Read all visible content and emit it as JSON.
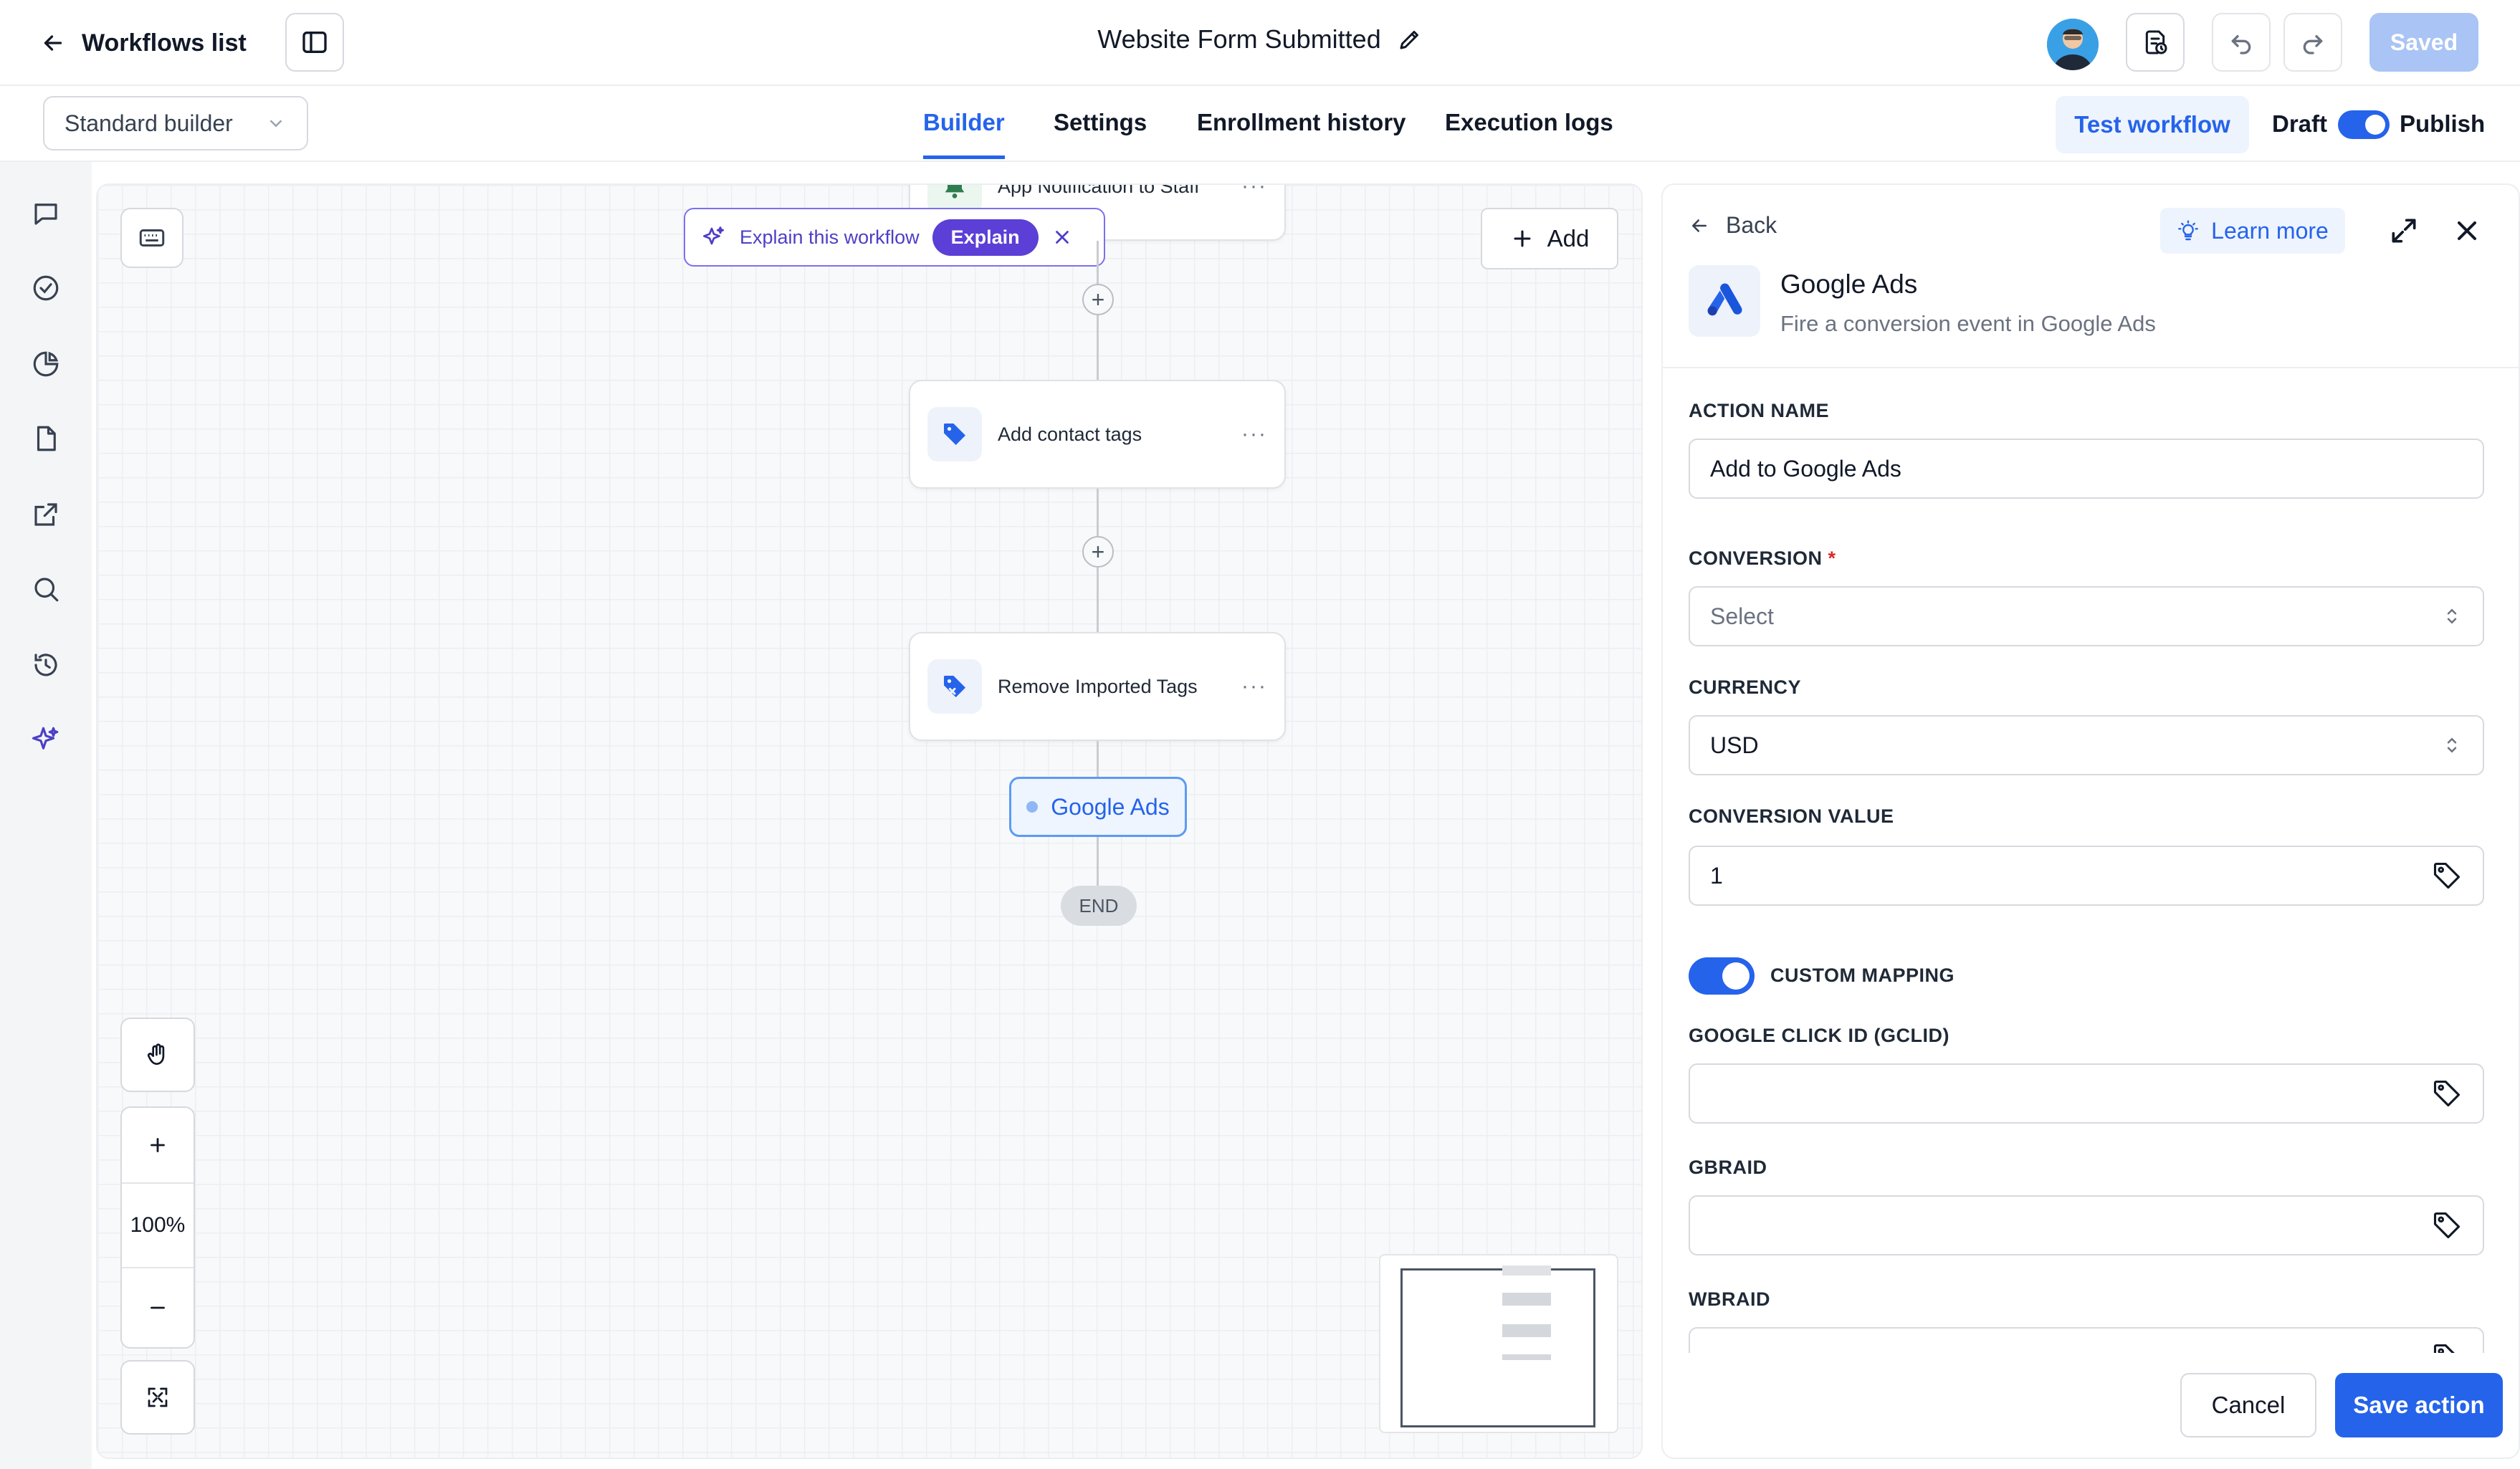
{
  "topbar": {
    "back_label": "Workflows list",
    "workflow_title": "Website Form Submitted",
    "saved_label": "Saved"
  },
  "subbar": {
    "builder_mode": "Standard builder",
    "tabs": [
      {
        "label": "Builder",
        "active": true
      },
      {
        "label": "Settings",
        "active": false
      },
      {
        "label": "Enrollment history",
        "active": false
      },
      {
        "label": "Execution logs",
        "active": false
      }
    ],
    "test_workflow_label": "Test workflow",
    "draft_label": "Draft",
    "publish_label": "Publish",
    "publish_toggle_on": true
  },
  "rail": {
    "icons": [
      "chat-icon",
      "check-circle-icon",
      "pie-chart-icon",
      "file-icon",
      "external-link-icon",
      "search-icon",
      "history-icon",
      "sparkles-icon"
    ]
  },
  "canvas": {
    "explain": {
      "text": "Explain this workflow",
      "button": "Explain"
    },
    "add_label": "Add",
    "nodes": [
      {
        "label": "App Notification to Staff"
      },
      {
        "label": "Add contact tags"
      },
      {
        "label": "Remove Imported Tags"
      }
    ],
    "active_node_label": "Google Ads",
    "end_label": "END",
    "zoom_label": "100%"
  },
  "panel": {
    "back_label": "Back",
    "learn_more_label": "Learn more",
    "title": "Google Ads",
    "subtitle": "Fire a conversion event in Google Ads",
    "action_name_label": "ACTION NAME",
    "action_name_value": "Add to Google Ads",
    "conversion_label": "CONVERSION",
    "required_mark": "*",
    "conversion_placeholder": "Select",
    "currency_label": "CURRENCY",
    "currency_value": "USD",
    "conversion_value_label": "CONVERSION VALUE",
    "conversion_value": "1",
    "custom_mapping_label": "CUSTOM MAPPING",
    "custom_mapping_on": true,
    "gclid_label": "GOOGLE CLICK ID (GCLID)",
    "gbraid_label": "GBRAID",
    "wbraid_label": "WBRAID",
    "cancel_label": "Cancel",
    "save_label": "Save action"
  },
  "colors": {
    "accent": "#2563eb",
    "ai_purple": "#5b3fd6",
    "saved_disabled": "#a9c4f5"
  }
}
